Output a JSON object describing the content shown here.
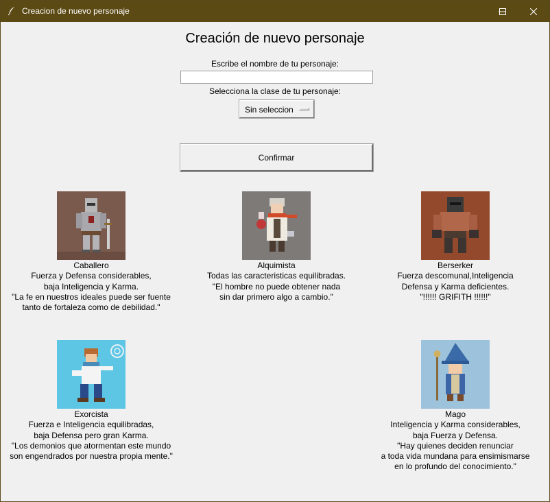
{
  "window": {
    "title": "Creacion de nuevo personaje",
    "icons": {
      "app": "feather-icon",
      "minimize": "minimize-icon",
      "maximize": "maximize-icon",
      "close": "close-icon"
    }
  },
  "form": {
    "title": "Creación de nuevo personaje",
    "name_label": "Escribe el nombre de tu personaje:",
    "name_value": "",
    "class_label": "Selecciona la clase de tu personaje:",
    "class_selected": "Sin seleccion",
    "confirm_label": "Confirmar"
  },
  "characters": [
    {
      "name": "Caballero",
      "lines": [
        "Fuerza y Defensa considerables,",
        "baja Inteligencia y Karma.",
        "\"La fe en nuestros ideales puede ser fuente",
        "tanto de fortaleza como de debilidad.\""
      ]
    },
    {
      "name": "Alquimista",
      "lines": [
        "Todas las caracteristicas equilibradas.",
        "\"El hombre no puede obtener nada",
        "sin dar primero algo a cambio.\""
      ]
    },
    {
      "name": "Berserker",
      "lines": [
        "Fuerza descomunal,Inteligencia",
        "Defensa y Karma deficientes.",
        "\"!!!!!! GRIFITH !!!!!!\""
      ]
    },
    {
      "name": "Exorcista",
      "lines": [
        "Fuerza e Inteligencia equilibradas,",
        "baja Defensa pero gran Karma.",
        "\"Los demonios que atormentan este mundo",
        "son engendrados por nuestra propia mente.\""
      ]
    },
    {
      "name": "Mago",
      "lines": [
        "Inteligencia y Karma considerables,",
        "baja Fuerza y Defensa.",
        "\"Hay quienes deciden renunciar",
        "a toda vida mundana para ensimismarse",
        "en lo profundo del conocimiento.\""
      ]
    }
  ]
}
